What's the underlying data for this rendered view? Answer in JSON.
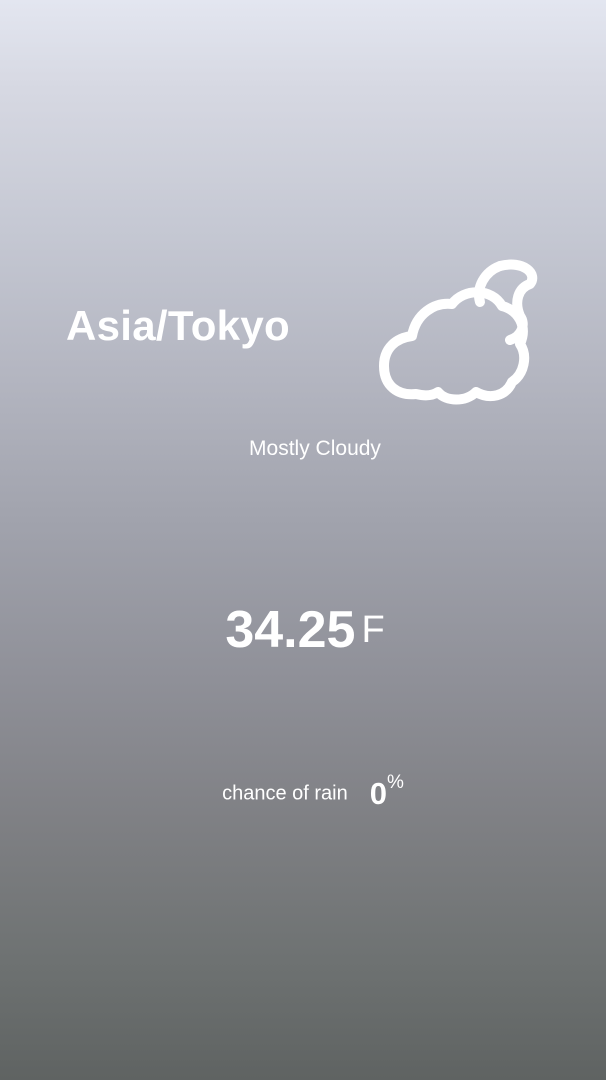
{
  "location": {
    "name": "Asia/Tokyo"
  },
  "weather": {
    "icon": "cloudy-night-icon",
    "condition": "Mostly Cloudy",
    "temperature": "34.25",
    "temperature_unit": "F",
    "rain_label": "chance of rain",
    "rain_chance": "0",
    "rain_unit": "%"
  },
  "colors": {
    "background_top": "#e3e6f0",
    "background_bottom": "#5f6362",
    "text": "#ffffff"
  }
}
